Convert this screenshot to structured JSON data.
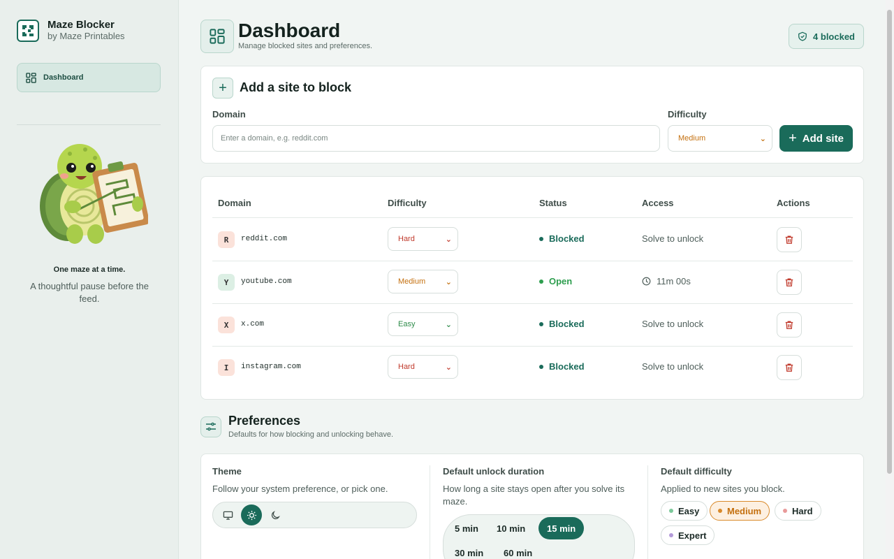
{
  "brand": {
    "title": "Maze Blocker",
    "subtitle": "by Maze Printables"
  },
  "sidebar": {
    "nav": [
      {
        "label": "Dashboard",
        "icon": "dashboard-grid-icon",
        "active": true
      }
    ],
    "tagline_title": "One maze at a time.",
    "tagline_text": "A thoughtful pause before the feed."
  },
  "header": {
    "title": "Dashboard",
    "subtitle": "Manage blocked sites and preferences.",
    "badge": "4 blocked"
  },
  "add_site": {
    "title": "Add a site to block",
    "domain_label": "Domain",
    "domain_placeholder": "Enter a domain, e.g. reddit.com",
    "difficulty_label": "Difficulty",
    "difficulty_value": "Medium",
    "button_label": "Add site"
  },
  "table": {
    "headers": [
      "Domain",
      "Difficulty",
      "Status",
      "Access",
      "Actions"
    ],
    "rows": [
      {
        "letter": "R",
        "domain": "reddit.com",
        "difficulty": "Hard",
        "status": "Blocked",
        "access": "Solve to unlock"
      },
      {
        "letter": "Y",
        "domain": "youtube.com",
        "difficulty": "Medium",
        "status": "Open",
        "access": "11m 00s"
      },
      {
        "letter": "X",
        "domain": "x.com",
        "difficulty": "Easy",
        "status": "Blocked",
        "access": "Solve to unlock"
      },
      {
        "letter": "I",
        "domain": "instagram.com",
        "difficulty": "Hard",
        "status": "Blocked",
        "access": "Solve to unlock"
      }
    ]
  },
  "preferences": {
    "title": "Preferences",
    "subtitle": "Defaults for how blocking and unlocking behave.",
    "theme": {
      "title": "Theme",
      "desc": "Follow your system preference, or pick one.",
      "options": [
        "system",
        "light",
        "dark"
      ],
      "selected": "light"
    },
    "duration": {
      "title": "Default unlock duration",
      "desc": "How long a site stays open after you solve its maze.",
      "options": [
        "5 min",
        "10 min",
        "15 min",
        "30 min",
        "60 min"
      ],
      "selected": "15 min"
    },
    "difficulty": {
      "title": "Default difficulty",
      "desc": "Applied to new sites you block.",
      "options": [
        "Easy",
        "Medium",
        "Hard",
        "Expert"
      ],
      "selected": "Medium"
    }
  },
  "colors": {
    "accent": "#1a6b5a",
    "hard": "#c0392b",
    "medium": "#c4700f",
    "easy": "#2e8b4a",
    "blocked": "#1a6b5a",
    "open": "#2e9e4f"
  }
}
